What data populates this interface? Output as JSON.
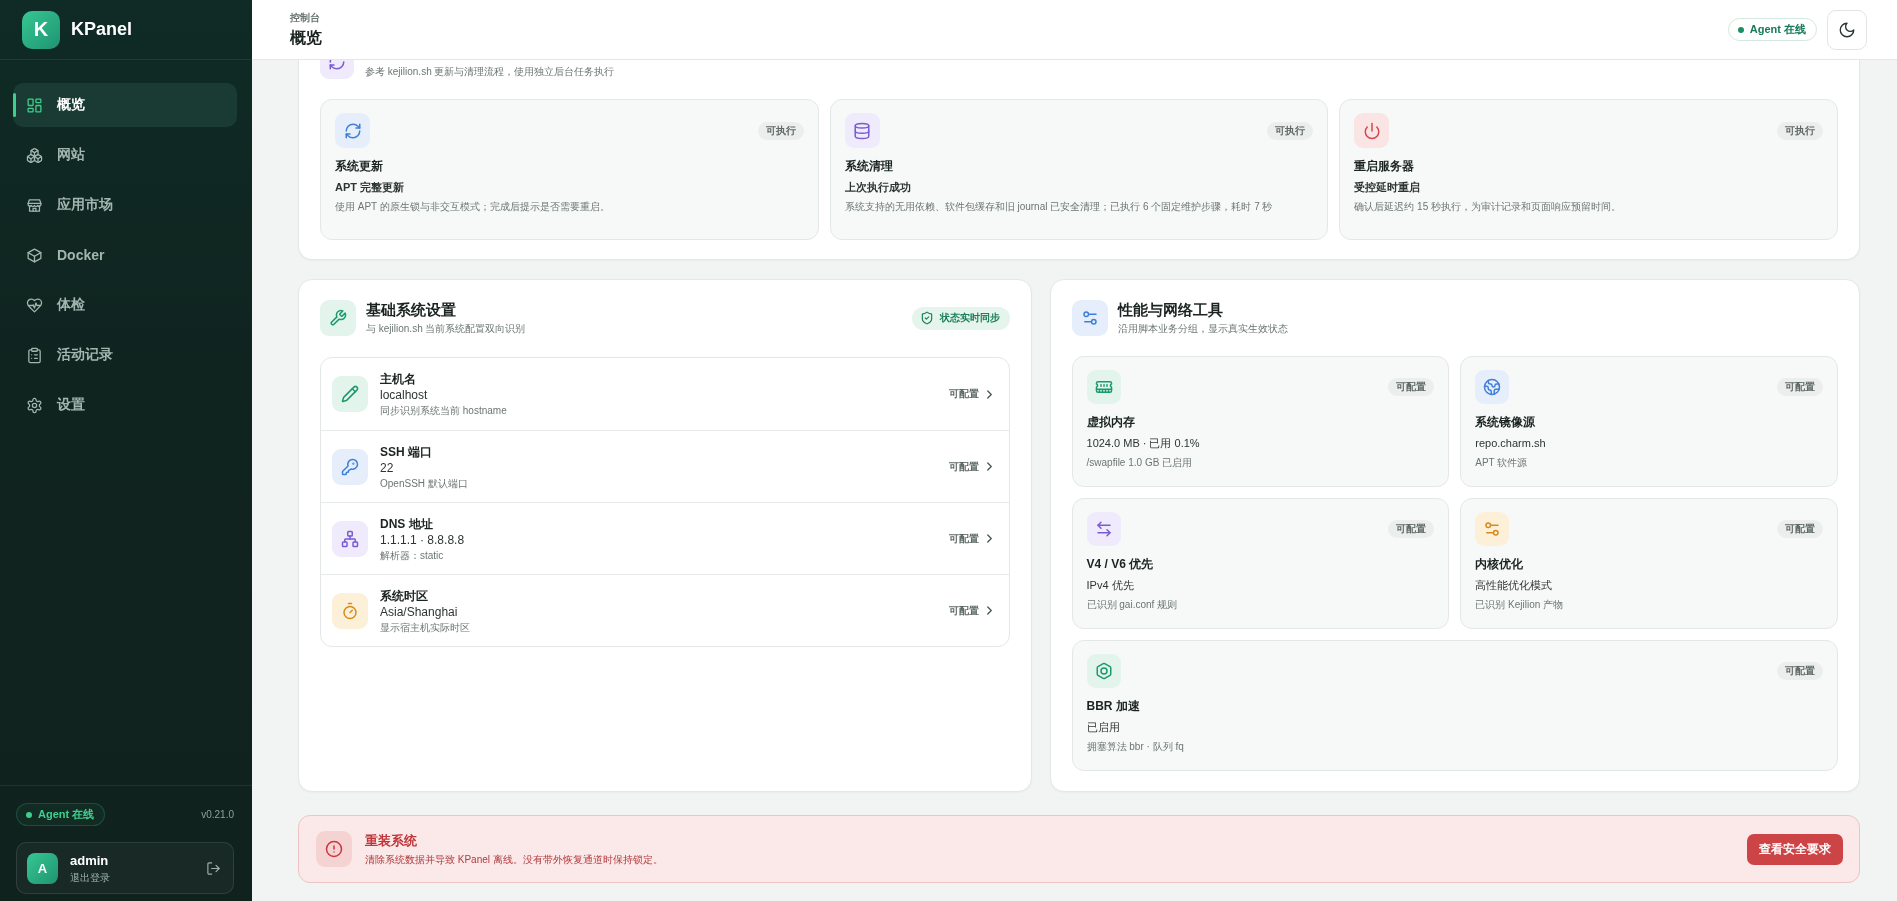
{
  "sidebar": {
    "logo_letter": "K",
    "brand": "KPanel",
    "nav": [
      {
        "label": "概览",
        "selected": true
      },
      {
        "label": "网站",
        "selected": false
      },
      {
        "label": "应用市场",
        "selected": false
      },
      {
        "label": "Docker",
        "selected": false
      },
      {
        "label": "体检",
        "selected": false
      },
      {
        "label": "活动记录",
        "selected": false
      },
      {
        "label": "设置",
        "selected": false
      }
    ],
    "agent_status": {
      "label": "Agent 在线",
      "online": true
    },
    "version": "v0.21.0",
    "user": {
      "avatar_letter": "A",
      "name": "admin",
      "logout": "退出登录"
    }
  },
  "topbar": {
    "breadcrumb": "控制台",
    "title": "概览",
    "agent_status": {
      "label": "Agent 在线",
      "online": true
    }
  },
  "maintenance": {
    "subtitle": "参考 kejilion.sh 更新与清理流程，使用独立后台任务执行",
    "tasks": [
      {
        "title": "系统更新",
        "subtitle": "APT 完整更新",
        "description": "使用 APT 的原生锁与非交互模式；完成后提示是否需要重启。",
        "badge": "可执行"
      },
      {
        "title": "系统清理",
        "subtitle": "上次执行成功",
        "description": "系统支持的无用依赖、软件包缓存和旧 journal 已安全清理；已执行 6 个固定维护步骤，耗时 7 秒",
        "badge": "可执行"
      },
      {
        "title": "重启服务器",
        "subtitle": "受控延时重启",
        "description": "确认后延迟约 15 秒执行，为审计记录和页面响应预留时间。",
        "badge": "可执行"
      }
    ]
  },
  "basic_settings": {
    "title": "基础系统设置",
    "subtitle": "与 kejilion.sh 当前系统配置双向识别",
    "sync_badge": "状态实时同步",
    "rows": [
      {
        "title": "主机名",
        "value": "localhost",
        "hint": "同步识别系统当前 hostname",
        "action": "可配置"
      },
      {
        "title": "SSH 端口",
        "value": "22",
        "hint": "OpenSSH 默认端口",
        "action": "可配置"
      },
      {
        "title": "DNS 地址",
        "value": "1.1.1.1 · 8.8.8.8",
        "hint": "解析器：static",
        "action": "可配置"
      },
      {
        "title": "系统时区",
        "value": "Asia/Shanghai",
        "hint": "显示宿主机实际时区",
        "action": "可配置"
      }
    ]
  },
  "tools": {
    "title": "性能与网络工具",
    "subtitle": "沿用脚本业务分组，显示真实生效状态",
    "items": [
      {
        "title": "虚拟内存",
        "value": "1024.0 MB · 已用 0.1%",
        "hint": "/swapfile 1.0 GB 已启用",
        "badge": "可配置"
      },
      {
        "title": "系统镜像源",
        "value": "repo.charm.sh",
        "hint": "APT 软件源",
        "badge": "可配置"
      },
      {
        "title": "V4 / V6 优先",
        "value": "IPv4 优先",
        "hint": "已识别 gai.conf 规则",
        "badge": "可配置"
      },
      {
        "title": "内核优化",
        "value": "高性能优化模式",
        "hint": "已识别 Kejilion 产物",
        "badge": "可配置"
      },
      {
        "title": "BBR 加速",
        "value": "已启用",
        "hint": "拥塞算法 bbr · 队列 fq",
        "badge": "可配置"
      }
    ]
  },
  "danger_zone": {
    "title": "重装系统",
    "description": "清除系统数据并导致 KPanel 离线。没有带外恢复通道时保持锁定。",
    "button": "查看安全要求"
  }
}
